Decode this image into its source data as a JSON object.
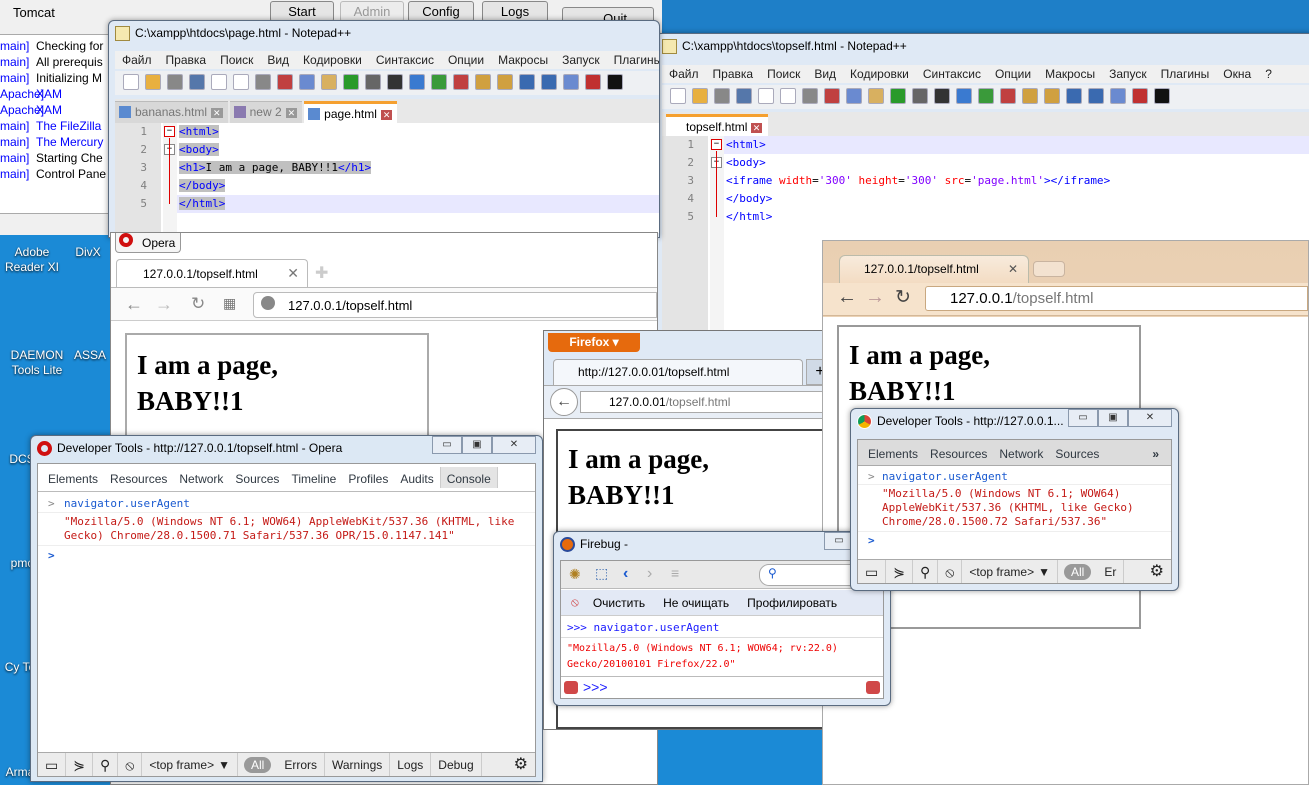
{
  "xampp": {
    "service": "Tomcat",
    "buttons": [
      "Start",
      "Admin",
      "Config",
      "Logs",
      "Quit"
    ],
    "log": [
      {
        "m": "main]",
        "t": "Checking for",
        "c": "#000"
      },
      {
        "m": "main]",
        "t": "All prerequis",
        "c": "#000"
      },
      {
        "m": "main]",
        "t": "Initializing M",
        "c": "#000"
      },
      {
        "m": "Apache]",
        "t": "XAM",
        "c": "#00f"
      },
      {
        "m": "Apache]",
        "t": "XAM",
        "c": "#00f"
      },
      {
        "m": "main]",
        "t": "The FileZilla",
        "c": "#00f"
      },
      {
        "m": "main]",
        "t": "The Mercury",
        "c": "#00f"
      },
      {
        "m": "main]",
        "t": "Starting Che",
        "c": "#000"
      },
      {
        "m": "main]",
        "t": "Control Pane",
        "c": "#000"
      }
    ]
  },
  "desktop": {
    "icons": [
      "Adobe Reader XI",
      "DivX",
      "DAEMON Tools Lite",
      "ASSA",
      "DCS",
      "pmc",
      "Cy Ter",
      "Arma"
    ]
  },
  "npp1": {
    "title": "C:\\xampp\\htdocs\\page.html - Notepad++",
    "menu": [
      "Файл",
      "Правка",
      "Поиск",
      "Вид",
      "Кодировки",
      "Синтаксис",
      "Опции",
      "Макросы",
      "Запуск",
      "Плагины"
    ],
    "tabs": [
      "bananas.html",
      "new  2",
      "page.html"
    ],
    "lines": [
      "<html>",
      "<body>",
      "<h1>I am a page, BABY!!1</h1>",
      "</body>",
      "</html>"
    ]
  },
  "npp2": {
    "title": "C:\\xampp\\htdocs\\topself.html - Notepad++",
    "menu": [
      "Файл",
      "Правка",
      "Поиск",
      "Вид",
      "Кодировки",
      "Синтаксис",
      "Опции",
      "Макросы",
      "Запуск",
      "Плагины",
      "Окна",
      "?"
    ],
    "tabs": [
      "topself.html"
    ],
    "lines": [
      "<html>",
      "<body>",
      "<iframe width='300' height='300' src='page.html'></iframe>",
      "</body>",
      "</html>"
    ]
  },
  "opera": {
    "menu_button": "Opera",
    "tab": "127.0.0.1/topself.html",
    "url": "127.0.0.1/topself.html",
    "h1_line1": "I am a page,",
    "h1_line2": "BABY!!1",
    "devtools": {
      "title": "Developer Tools - http://127.0.0.1/topself.html - Opera",
      "tabs": [
        "Elements",
        "Resources",
        "Network",
        "Sources",
        "Timeline",
        "Profiles",
        "Audits",
        "Console"
      ],
      "command": "navigator.userAgent",
      "result": "\"Mozilla/5.0 (Windows NT 6.1; WOW64) AppleWebKit/537.36 (KHTML, like Gecko) Chrome/28.0.1500.71 Safari/537.36 OPR/15.0.1147.141\"",
      "bottom": [
        "<top frame>",
        "All",
        "Errors",
        "Warnings",
        "Logs",
        "Debug"
      ]
    }
  },
  "firefox": {
    "menu_button": "Firefox",
    "tab": "http://127.0.0.01/topself.html",
    "url_host": "127.0.0.01",
    "url_path": "/topself.html",
    "h1_line1": "I am a page,",
    "h1_line2": "BABY!!1",
    "firebug": {
      "title": "Firebug -",
      "buttons": [
        "Очистить",
        "Не очищать",
        "Профилировать"
      ],
      "command": ">>> navigator.userAgent",
      "result": "\"Mozilla/5.0 (Windows NT 6.1; WOW64; rv:22.0) Gecko/20100101 Firefox/22.0\"",
      "prompt": ">>>"
    }
  },
  "chrome": {
    "tab": "127.0.0.1/topself.html",
    "url_host": "127.0.0.1",
    "url_path": "/topself.html",
    "h1_line1": "I am a page,",
    "h1_line2": "BABY!!1",
    "devtools": {
      "title": "Developer Tools - http://127.0.0.1...",
      "tabs": [
        "Elements",
        "Resources",
        "Network",
        "Sources"
      ],
      "more": "»",
      "command": "navigator.userAgent",
      "result": "\"Mozilla/5.0 (Windows NT 6.1; WOW64) AppleWebKit/537.36 (KHTML, like Gecko) Chrome/28.0.1500.72 Safari/537.36\"",
      "bottom": [
        "<top frame>",
        "All",
        "Er"
      ]
    }
  },
  "colors": {
    "desktop": "#1b8ad6",
    "tag": "#0000ff",
    "attr": "#ff0000",
    "string": "#8000ff",
    "console_cmd": "#1a5ad0",
    "console_result": "#c41a16",
    "firefox_orange": "#e66a0d"
  }
}
